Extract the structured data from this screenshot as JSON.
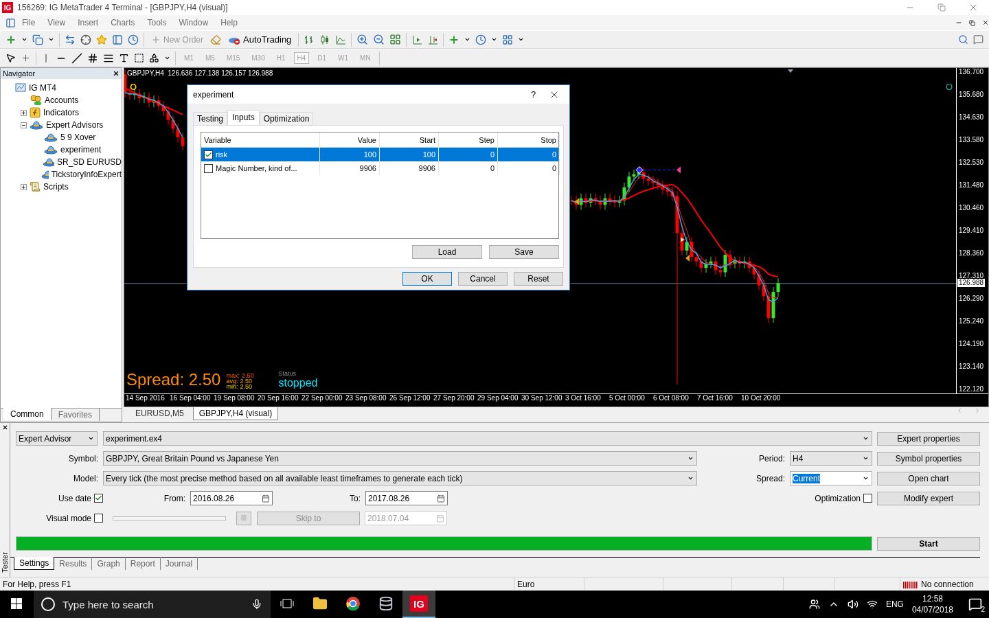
{
  "window": {
    "logo": "IG",
    "title": "156269: IG MetaTrader 4 Terminal - [GBPJPY,H4 (visual)]"
  },
  "menu": [
    "File",
    "View",
    "Insert",
    "Charts",
    "Tools",
    "Window",
    "Help"
  ],
  "toolbar": {
    "new_order": {
      "label": "New Order",
      "disabled": true
    },
    "autotrading": "AutoTrading"
  },
  "timeframes": [
    {
      "label": "M1",
      "selected": false
    },
    {
      "label": "M5",
      "selected": false
    },
    {
      "label": "M15",
      "selected": false
    },
    {
      "label": "M30",
      "selected": false
    },
    {
      "label": "H1",
      "selected": false
    },
    {
      "label": "H4",
      "selected": true
    },
    {
      "label": "D1",
      "selected": false
    },
    {
      "label": "W1",
      "selected": false
    },
    {
      "label": "MN",
      "selected": false
    }
  ],
  "navigator": {
    "title": "Navigator",
    "tree": [
      {
        "label": "IG MT4",
        "kind": "terminal",
        "children": [
          {
            "label": "Accounts",
            "kind": "accounts"
          },
          {
            "label": "Indicators",
            "kind": "indicators",
            "expanded": false
          },
          {
            "label": "Expert Advisors",
            "kind": "experts",
            "expanded": true,
            "children": [
              {
                "label": "5 9 Xover",
                "kind": "expert"
              },
              {
                "label": "experiment",
                "kind": "expert"
              },
              {
                "label": "SR_SD EURUSD",
                "kind": "expert"
              },
              {
                "label": "TickstoryInfoExpert",
                "kind": "expert"
              }
            ]
          },
          {
            "label": "Scripts",
            "kind": "scripts",
            "expanded": false
          }
        ]
      }
    ],
    "tabs": [
      {
        "label": "Common",
        "selected": true
      },
      {
        "label": "Favorites",
        "selected": false
      }
    ]
  },
  "chart": {
    "header": "GBPJPY,H4  126.636 127.138 126.157 126.988",
    "left_mark": "O",
    "right_mark": "O",
    "price_labels": [
      "136.700",
      "135.680",
      "134.630",
      "133.580",
      "132.530",
      "131.480",
      "130.460",
      "129.410",
      "128.360",
      "127.310",
      "126.290",
      "125.240",
      "124.190",
      "123.140",
      "122.120"
    ],
    "current_price": "126.988",
    "time_labels": [
      "14 Sep 2016",
      "16 Sep 04:00",
      "19 Sep 08:00",
      "20 Sep 16:00",
      "22 Sep 00:00",
      "23 Sep 08:00",
      "26 Sep 12:00",
      "27 Sep 20:00",
      "29 Sep 04:00",
      "30 Sep 12:00",
      "3 Oct 16:00",
      "5 Oct 00:00",
      "6 Oct 08:00",
      "7 Oct 16:00",
      "10 Oct 20:00"
    ],
    "spread": {
      "text": "Spread: 2.50",
      "stats": [
        {
          "label": "max:",
          "value": "2.50"
        },
        {
          "label": "avg:",
          "value": "2.50"
        },
        {
          "label": "min:",
          "value": "2.50"
        }
      ]
    },
    "status": {
      "label": "Status",
      "value": "stopped"
    }
  },
  "chart_tabs": [
    {
      "label": "EURUSD,M5",
      "selected": false
    },
    {
      "label": "GBPJPY,H4 (visual)",
      "selected": true
    }
  ],
  "dialog": {
    "title": "experiment",
    "help": "?",
    "tabs": [
      {
        "label": "Testing",
        "selected": false
      },
      {
        "label": "Inputs",
        "selected": true
      },
      {
        "label": "Optimization",
        "selected": false
      }
    ],
    "columns": [
      "Variable",
      "Value",
      "Start",
      "Step",
      "Stop"
    ],
    "rows": [
      {
        "checked": true,
        "selected": true,
        "cells": [
          "risk",
          "100",
          "100",
          "0",
          "0"
        ]
      },
      {
        "checked": false,
        "selected": false,
        "cells": [
          "Magic Number, kind of...",
          "9906",
          "9906",
          "0",
          "0"
        ]
      }
    ],
    "buttons": [
      "Load",
      "Save"
    ],
    "footer_buttons": [
      "OK",
      "Cancel",
      "Reset"
    ]
  },
  "tester": {
    "label": "Tester",
    "mode": "Expert Advisor",
    "expert": "experiment.ex4",
    "symbol_label": "Symbol:",
    "symbol": "GBPJPY, Great Britain Pound vs Japanese Yen",
    "model_label": "Model:",
    "model": "Every tick (the most precise method based on all available least timeframes to generate each tick)",
    "period_label": "Period:",
    "period": "H4",
    "spread_label": "Spread:",
    "spread": "Current",
    "use_date_label": "Use date",
    "use_date": true,
    "from_label": "From:",
    "from": "2016.08.26",
    "to_label": "To:",
    "to": "2017.08.26",
    "visual_mode_label": "Visual mode",
    "visual_mode": false,
    "skip_to": {
      "label": "Skip to",
      "disabled": true
    },
    "skip_date": "2018.07.04",
    "optimization_label": "Optimization",
    "optimization": false,
    "side_buttons": [
      "Expert properties",
      "Symbol properties",
      "Open chart",
      "Modify expert"
    ],
    "progress": {
      "level": 1
    },
    "start": "Start",
    "tabs": [
      {
        "label": "Settings",
        "selected": true
      },
      {
        "label": "Results",
        "selected": false
      },
      {
        "label": "Graph",
        "selected": false
      },
      {
        "label": "Report",
        "selected": false
      },
      {
        "label": "Journal",
        "selected": false
      }
    ]
  },
  "status_bar": {
    "help": "For Help, press F1",
    "profile": "Euro",
    "connection": "No connection"
  },
  "taskbar": {
    "search_placeholder": "Type here to search",
    "app_label": "IG",
    "language": "ENG",
    "time": "12:58",
    "date": "04/07/2018",
    "notifications": "2"
  }
}
